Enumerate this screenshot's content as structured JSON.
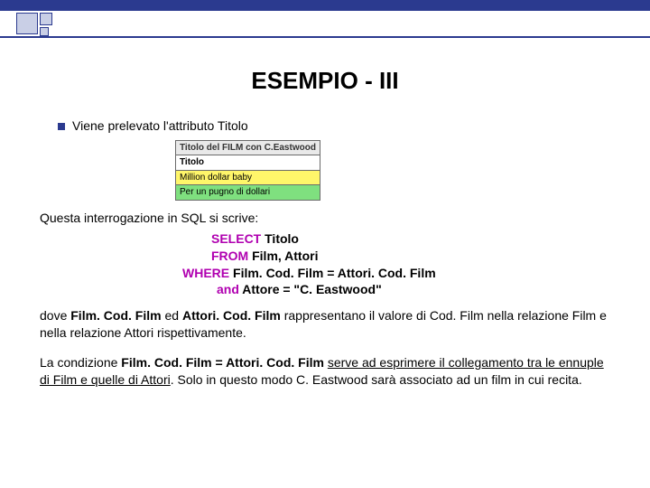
{
  "title": "ESEMPIO - III",
  "line1": "Viene prelevato l'attributo Titolo",
  "table": {
    "caption": "Titolo del FILM con C.Eastwood",
    "col": "Titolo",
    "rows": [
      "Million dollar baby",
      "Per un pugno di dollari"
    ]
  },
  "line2": "Questa interrogazione in SQL si scrive:",
  "sql": {
    "k_select": "SELECT",
    "v_select": " Titolo",
    "k_from": "FROM",
    "v_from": " Film, Attori",
    "k_where": "WHERE",
    "v_where": " Film. Cod. Film = Attori. Cod. Film",
    "k_and": "and",
    "v_and": " Attore = \"C. Eastwood\""
  },
  "para1a": "dove ",
  "para1b": "Film. Cod. Film",
  "para1c": " ed ",
  "para1d": "Attori. Cod. Film",
  "para1e": " rappresentano il valore di Cod. Film nella relazione Film e nella relazione Attori rispettivamente.",
  "para2a": "La condizione ",
  "para2b": "Film. Cod. Film = Attori. Cod. Film ",
  "para2c": "serve ad esprimere il collegamento tra le ennuple di Film e quelle di Attori",
  "para2d": ". Solo in questo modo C. Eastwood sarà associato ad un film in cui recita."
}
